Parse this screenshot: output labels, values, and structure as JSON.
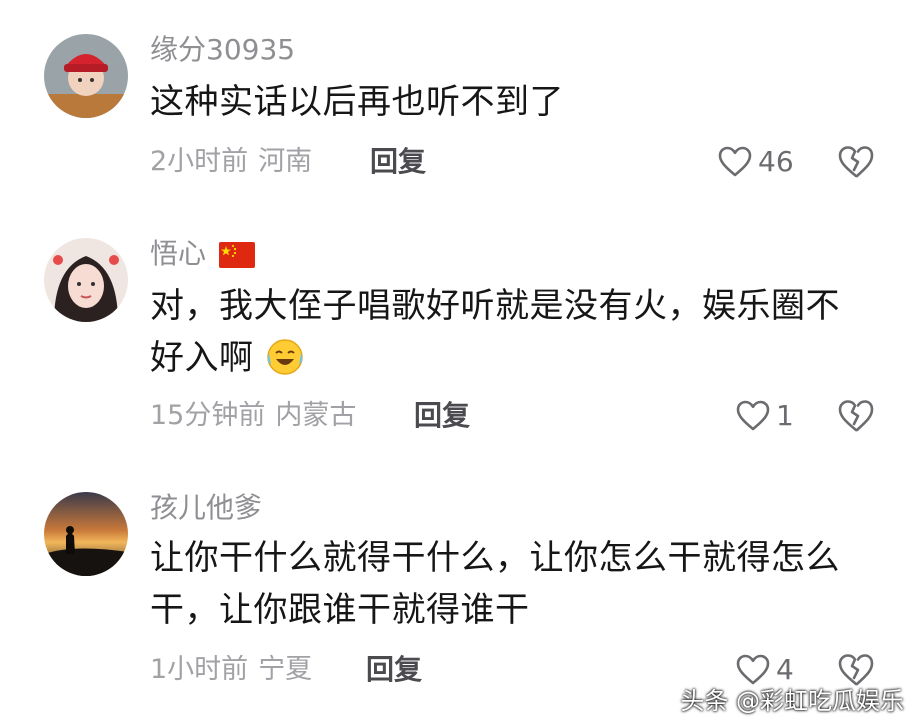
{
  "comments": [
    {
      "username": "缘分30935",
      "text_lines": [
        "这种实话以后再也听不到了"
      ],
      "time": "2小时前",
      "location": "河南",
      "reply_label": "回复",
      "likes": "46"
    },
    {
      "username": "悟心",
      "text_lines": [
        "对，我大侄子唱歌好听就是没有火，娱乐圈不",
        "好入啊"
      ],
      "time": "15分钟前",
      "location": "内蒙古",
      "reply_label": "回复",
      "likes": "1"
    },
    {
      "username": "孩儿他爹",
      "text_lines": [
        "让你干什么就得干什么，让你怎么干就得怎么",
        "干，让你跟谁干就得谁干"
      ],
      "time": "1小时前",
      "location": "宁夏",
      "reply_label": "回复",
      "likes": "4"
    }
  ],
  "watermark": "头条 @彩虹吃瓜娱乐",
  "colors": {
    "text": "#161616",
    "muted": "#a1a1a6",
    "flag": "#de2910"
  }
}
